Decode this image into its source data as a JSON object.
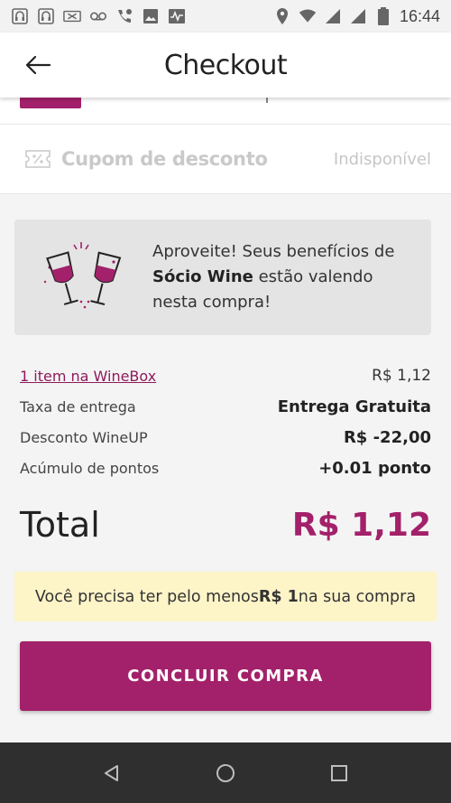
{
  "status_bar": {
    "time": "16:44",
    "left_icons": [
      "voicemail-icon",
      "gallery-icon",
      "activity-icon"
    ],
    "right_icons": [
      "location-icon",
      "wifi-icon",
      "signal-icon",
      "battery-icon"
    ]
  },
  "app_bar": {
    "title": "Checkout",
    "back_icon": "arrow-left-icon"
  },
  "coupon": {
    "label": "Cupom de desconto",
    "status": "Indisponível"
  },
  "benefit": {
    "line_prefix": "Aproveite! Seus benefícios de",
    "highlight": "Sócio Wine",
    "line_suffix": " estão valendo nesta compra!"
  },
  "summary": {
    "items": [
      {
        "label": "1 item na WineBox",
        "value": "R$ 1,12"
      },
      {
        "label": "Taxa de entrega",
        "value": "Entrega Gratuita"
      },
      {
        "label": "Desconto WineUP",
        "value": "R$ -22,00"
      },
      {
        "label": "Acúmulo de pontos",
        "value": "+0.01 ponto"
      }
    ]
  },
  "total": {
    "label": "Total",
    "value": "R$ 1,12"
  },
  "notice": {
    "prefix": "Você precisa ter pelo menos ",
    "amount": "R$ 1",
    "suffix": " na sua compra"
  },
  "cta": {
    "label": "CONCLUIR COMPRA"
  },
  "colors": {
    "brand": "#a3216a",
    "notice_bg": "#fdf4c8",
    "card_bg": "#e4e4e4"
  }
}
